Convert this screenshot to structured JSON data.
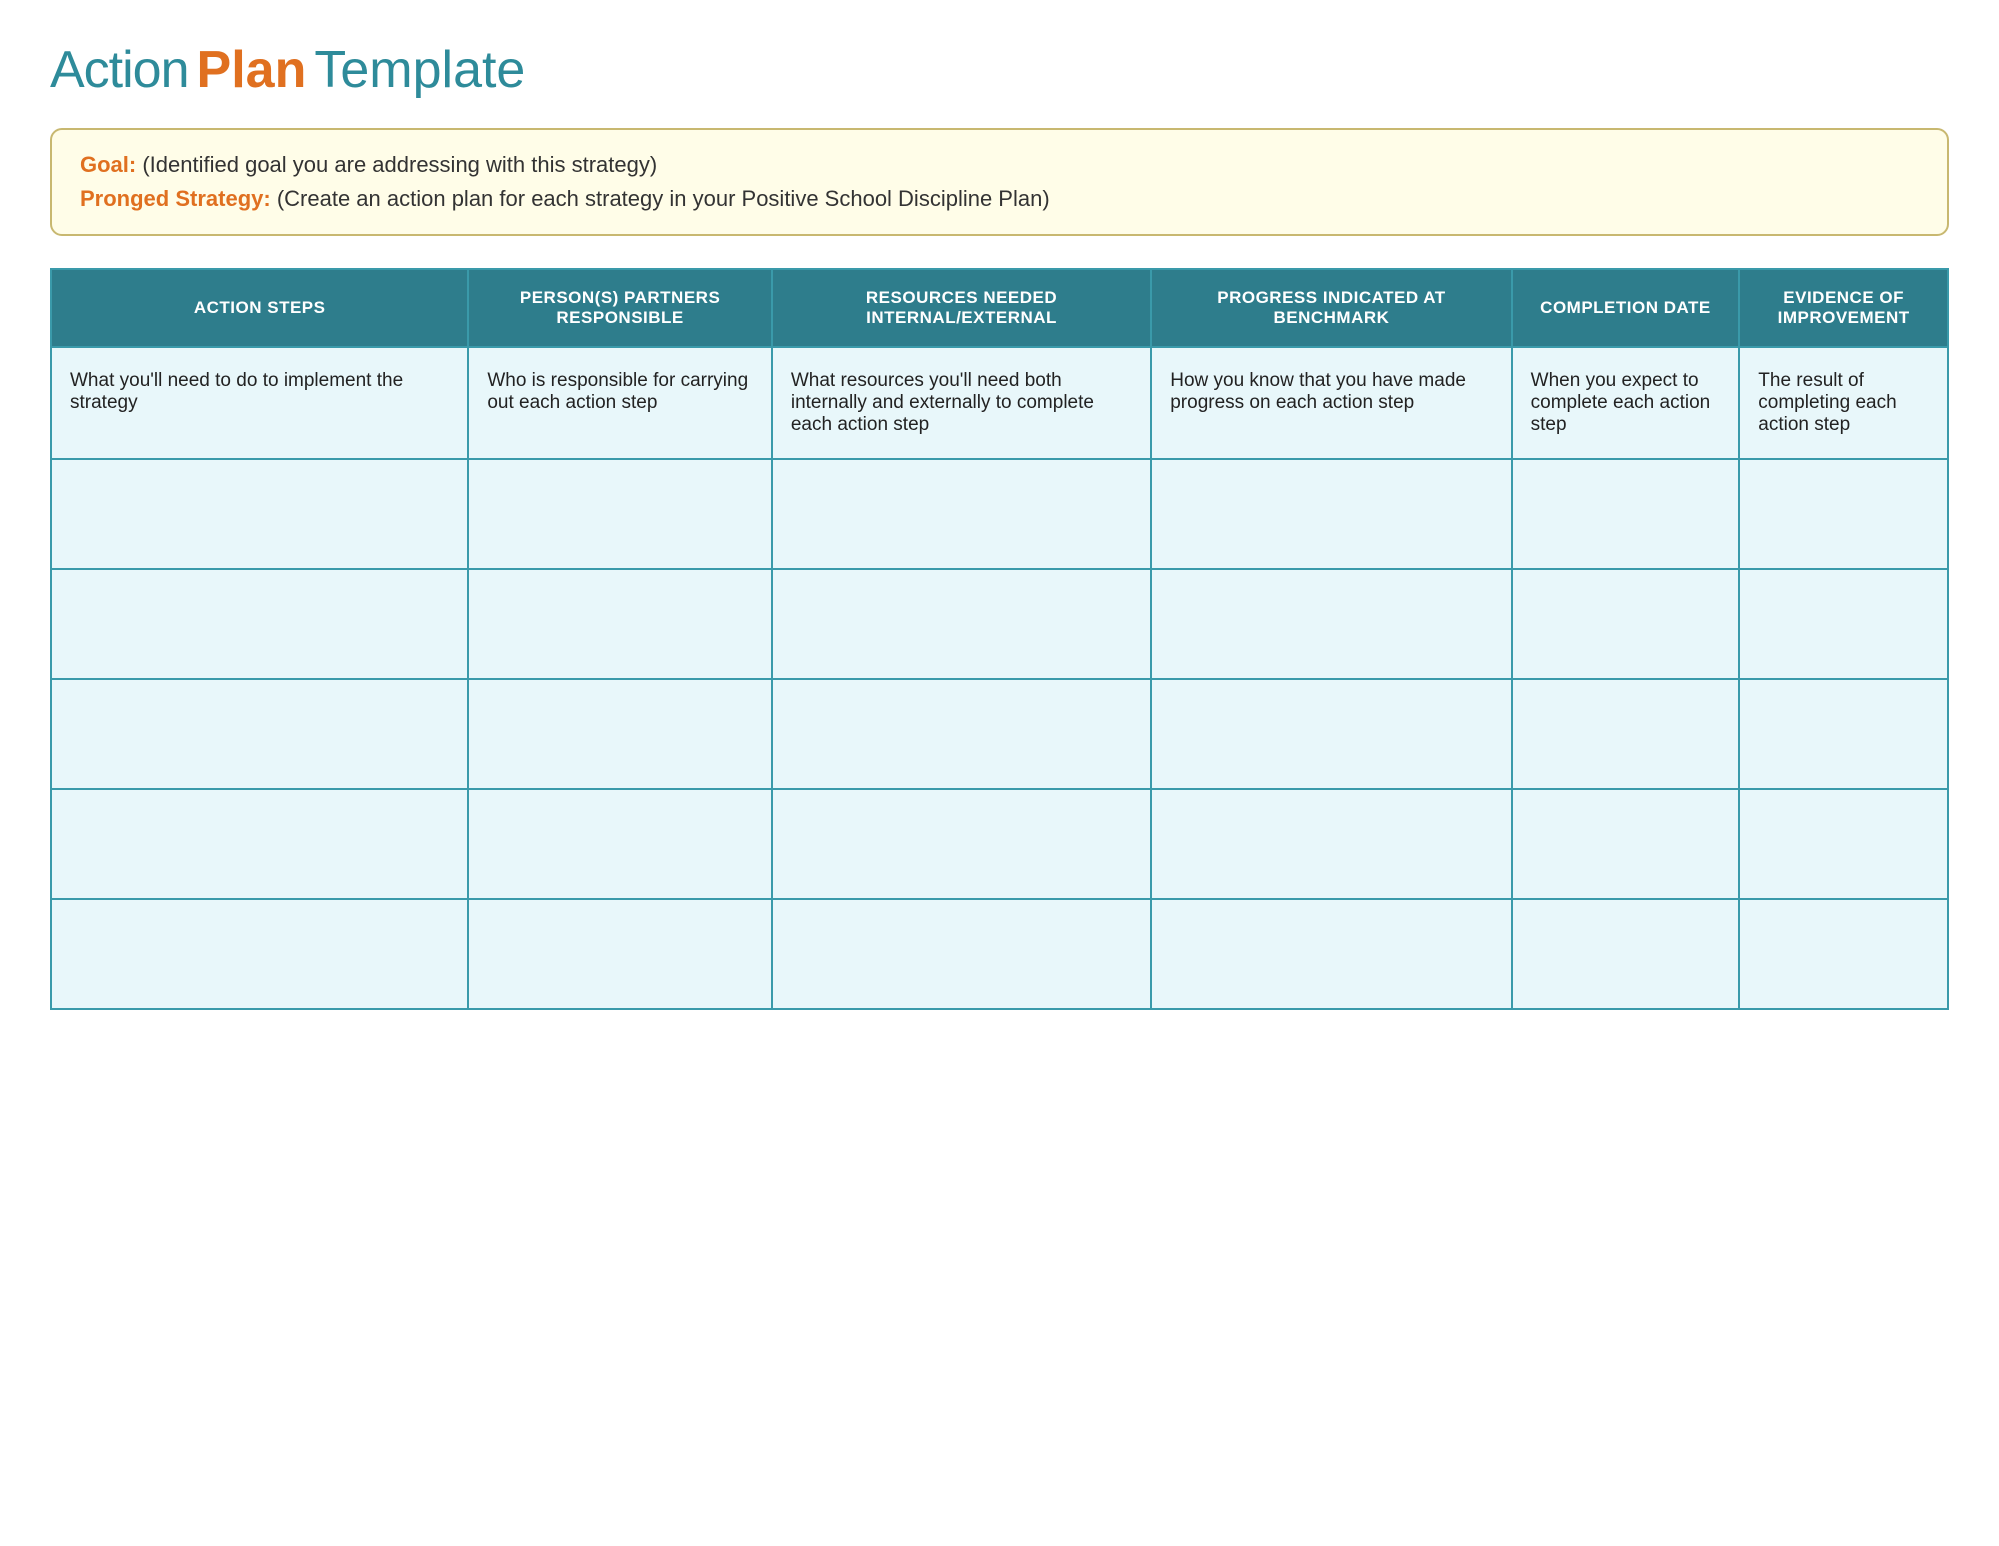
{
  "title": {
    "action": "Action",
    "plan": "Plan",
    "template": "Template"
  },
  "goal_box": {
    "goal_label": "Goal:",
    "goal_text": "(Identified goal you are addressing with this strategy)",
    "strategy_label": "Pronged Strategy:",
    "strategy_text": " (Create an action plan for each strategy in your Positive School Discipline Plan)"
  },
  "table": {
    "headers": {
      "action_steps": "ACTION STEPS",
      "persons_responsible": "PERSON(S) PARTNERS RESPONSIBLE",
      "resources_needed": "RESOURCES NEEDED INTERNAL/EXTERNAL",
      "progress_benchmark": "PROGRESS INDICATED AT BENCHMARK",
      "completion_date": "COMPLETION DATE",
      "evidence_improvement": "EVIDENCE OF IMPROVEMENT"
    },
    "first_row": {
      "action_steps": "What you'll need to do to implement the strategy",
      "persons_responsible": "Who is responsible for carrying out each action step",
      "resources_needed": "What resources you'll need both internally and externally to complete each action step",
      "progress_benchmark": "How you know that you have made progress on each action step",
      "completion_date": "When you expect to complete each action step",
      "evidence_improvement": "The result of completing each action step"
    },
    "empty_rows": 5
  }
}
